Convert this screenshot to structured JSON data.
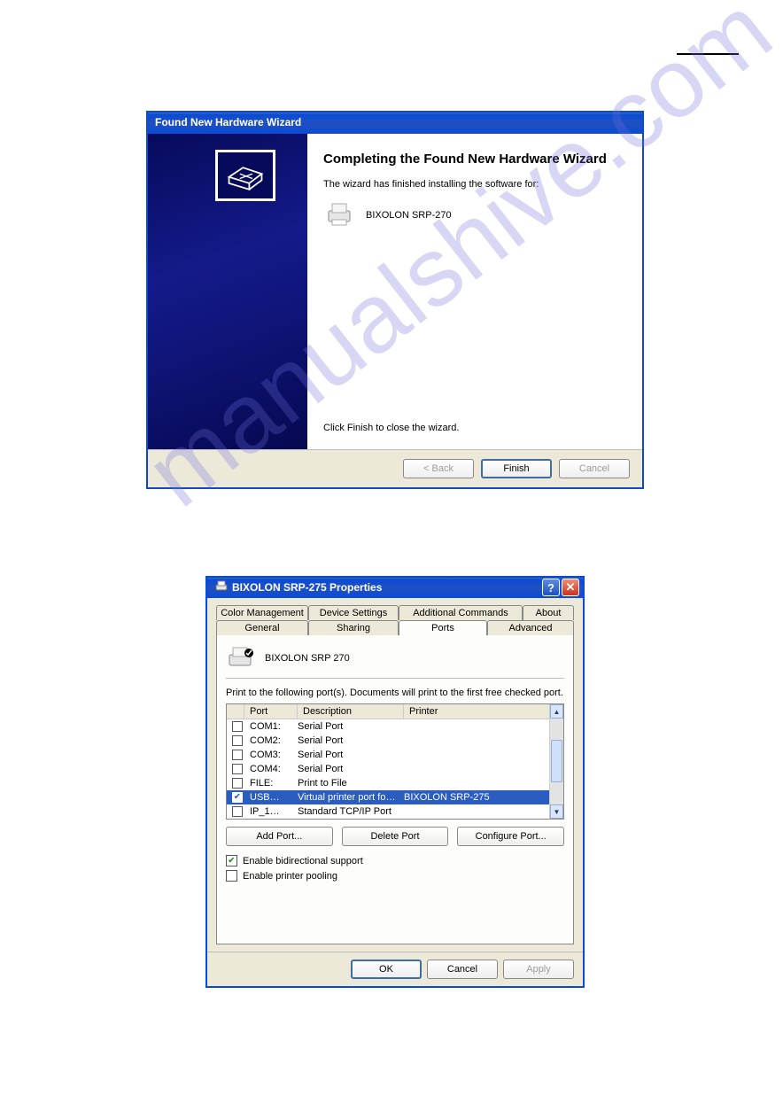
{
  "watermark": "manualshive.com",
  "wizard": {
    "title": "Found New Hardware Wizard",
    "heading": "Completing the Found New Hardware Wizard",
    "message": "The wizard has finished installing the software for:",
    "device": "BIXOLON SRP-270",
    "bottom_msg": "Click Finish to close the wizard.",
    "buttons": {
      "back": "< Back",
      "finish": "Finish",
      "cancel": "Cancel"
    }
  },
  "props": {
    "title": "BIXOLON SRP-275 Properties",
    "tabs_row1": [
      "Color Management",
      "Device Settings",
      "Additional Commands",
      "About"
    ],
    "tabs_row2": [
      "General",
      "Sharing",
      "Ports",
      "Advanced"
    ],
    "printer_name": "BIXOLON SRP 270",
    "instruction": "Print to the following port(s). Documents will print to the first free checked port.",
    "columns": {
      "port": "Port",
      "desc": "Description",
      "printer": "Printer"
    },
    "rows": [
      {
        "checked": false,
        "port": "COM1:",
        "desc": "Serial Port",
        "printer": ""
      },
      {
        "checked": false,
        "port": "COM2:",
        "desc": "Serial Port",
        "printer": ""
      },
      {
        "checked": false,
        "port": "COM3:",
        "desc": "Serial Port",
        "printer": ""
      },
      {
        "checked": false,
        "port": "COM4:",
        "desc": "Serial Port",
        "printer": ""
      },
      {
        "checked": false,
        "port": "FILE:",
        "desc": "Print to File",
        "printer": ""
      },
      {
        "checked": true,
        "port": "USB…",
        "desc": "Virtual printer port fo…",
        "printer": "BIXOLON SRP-275",
        "selected": true
      },
      {
        "checked": false,
        "port": "IP_1…",
        "desc": "Standard TCP/IP Port",
        "printer": ""
      }
    ],
    "port_buttons": {
      "add": "Add Port...",
      "delete": "Delete Port",
      "configure": "Configure Port..."
    },
    "checkboxes": {
      "bidi": "Enable bidirectional support",
      "pool": "Enable printer pooling"
    },
    "bidi_checked": true,
    "pool_checked": false,
    "buttons": {
      "ok": "OK",
      "cancel": "Cancel",
      "apply": "Apply"
    }
  }
}
